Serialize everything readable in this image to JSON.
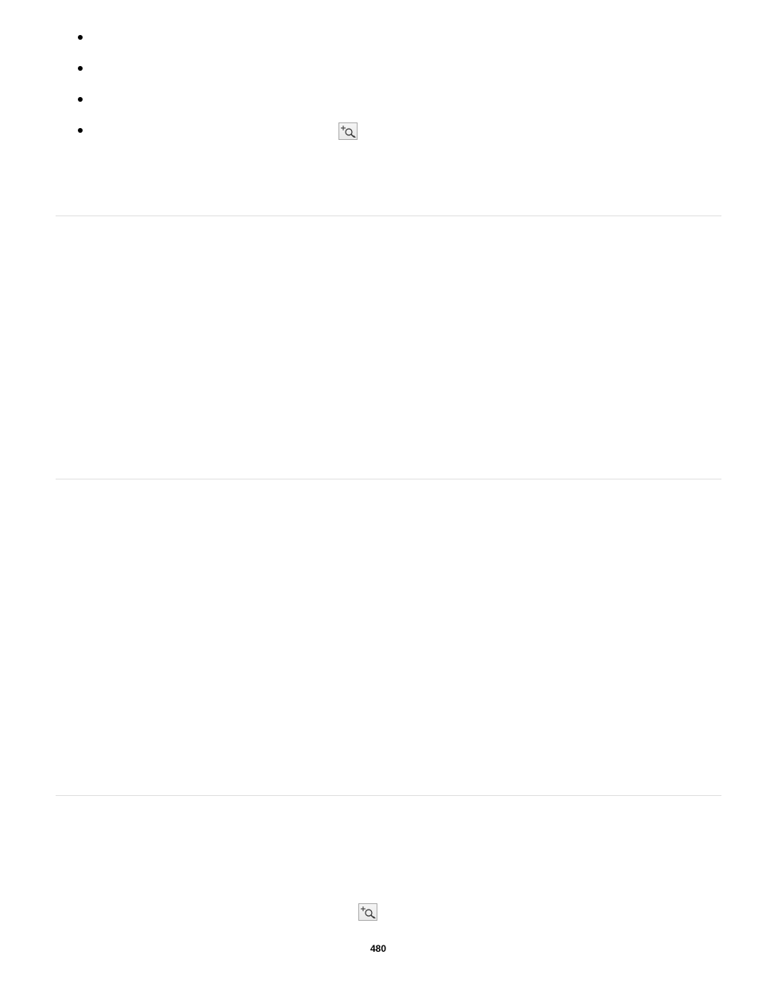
{
  "page_number": "480"
}
